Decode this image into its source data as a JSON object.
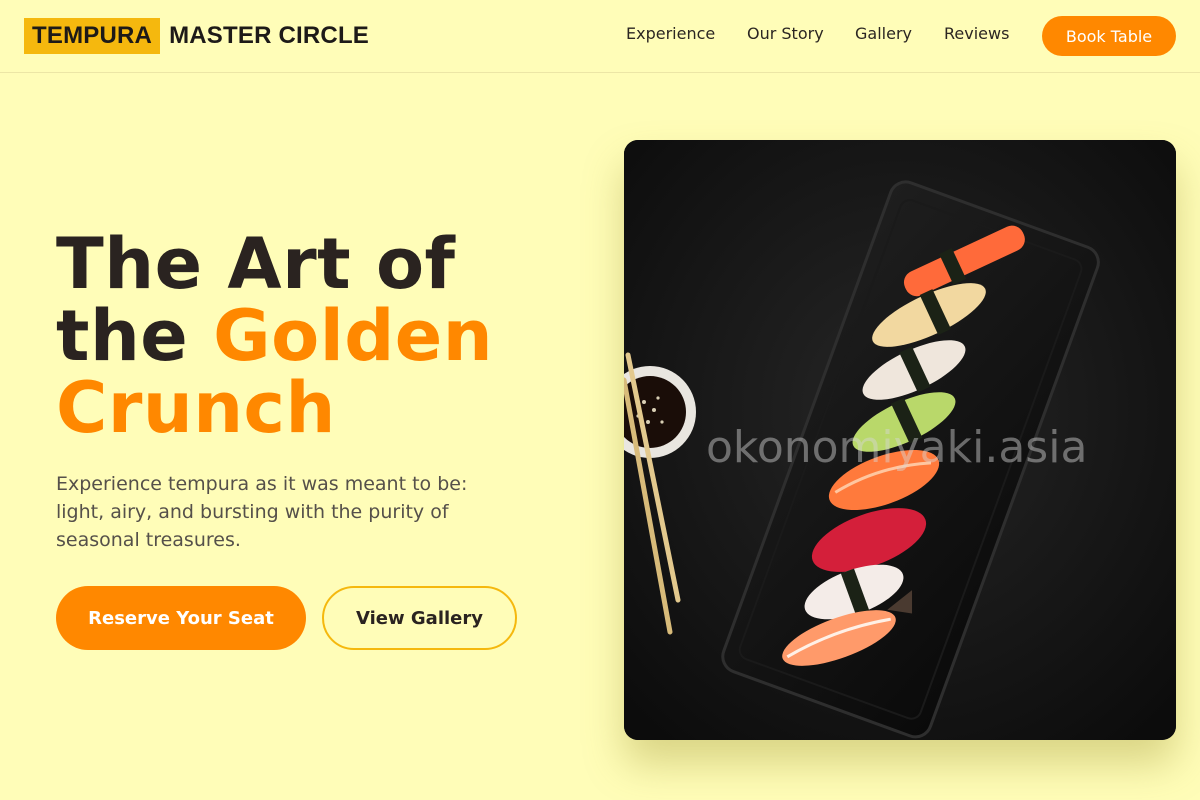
{
  "brand": {
    "highlight": "TEMPURA",
    "rest": "MASTER CIRCLE"
  },
  "nav": [
    {
      "label": "Experience"
    },
    {
      "label": "Our Story"
    },
    {
      "label": "Gallery"
    },
    {
      "label": "Reviews"
    }
  ],
  "header": {
    "cta_label": "Book Table"
  },
  "hero": {
    "title_line1": "The Art of",
    "title_line2_plain": "the ",
    "title_line2_accent": "Golden",
    "title_line3_accent": "Crunch",
    "subtitle": "Experience tempura as it was meant to be: light, airy, and bursting with the purity of seasonal treasures.",
    "primary_cta": "Reserve Your Seat",
    "secondary_cta": "View Gallery",
    "watermark": "okonomiyaki.asia"
  },
  "colors": {
    "background": "#FFFDB8",
    "accent": "#FF8800",
    "brand_yellow": "#F5B80E",
    "text_dark": "#2A2320"
  },
  "image": {
    "subject": "sushi platter on black plate with soy sauce and chopsticks"
  }
}
